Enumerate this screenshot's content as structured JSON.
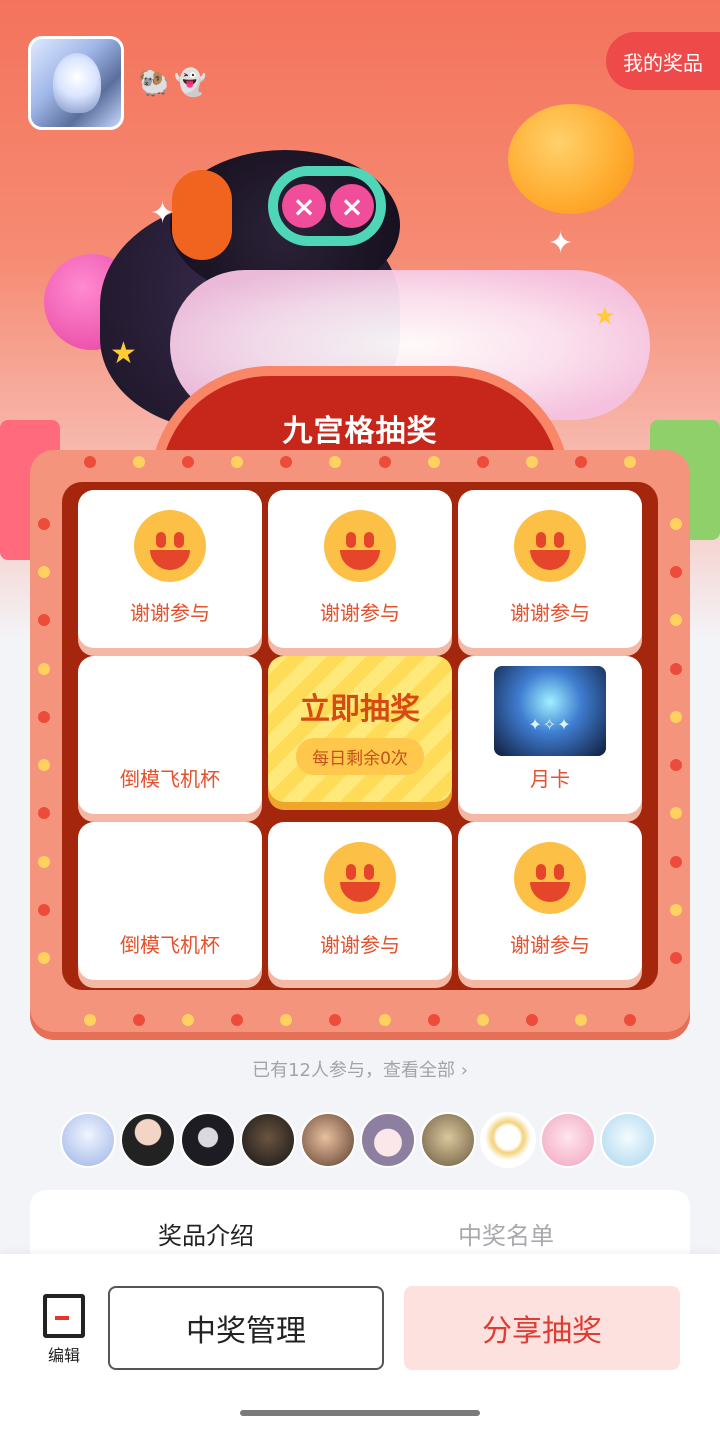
{
  "header": {
    "my_prize_label": "我的奖品",
    "badges": [
      "🐏",
      "👻"
    ]
  },
  "board": {
    "title": "九宫格抽奖",
    "cells": [
      {
        "label": "谢谢参与",
        "icon": "smiley-icon"
      },
      {
        "label": "谢谢参与",
        "icon": "smiley-icon"
      },
      {
        "label": "谢谢参与",
        "icon": "smiley-icon"
      },
      {
        "label": "倒模飞机杯",
        "icon": ""
      },
      {
        "label": "立即抽奖",
        "sub": "每日剩余0次"
      },
      {
        "label": "月卡",
        "icon": "prize-image"
      },
      {
        "label": "倒模飞机杯",
        "icon": ""
      },
      {
        "label": "谢谢参与",
        "icon": "smiley-icon"
      },
      {
        "label": "谢谢参与",
        "icon": "smiley-icon"
      }
    ]
  },
  "participants": {
    "text": "已有12人参与，查看全部",
    "chevron": "›"
  },
  "tabs": {
    "prize_intro": "奖品介绍",
    "winners": "中奖名单"
  },
  "bottom": {
    "edit_label": "编辑",
    "manage_label": "中奖管理",
    "share_label": "分享抽奖"
  },
  "colors": {
    "accent": "#ef4a4a",
    "board": "#f5947c",
    "board_inner": "#a4260c",
    "label": "#e5502d"
  }
}
